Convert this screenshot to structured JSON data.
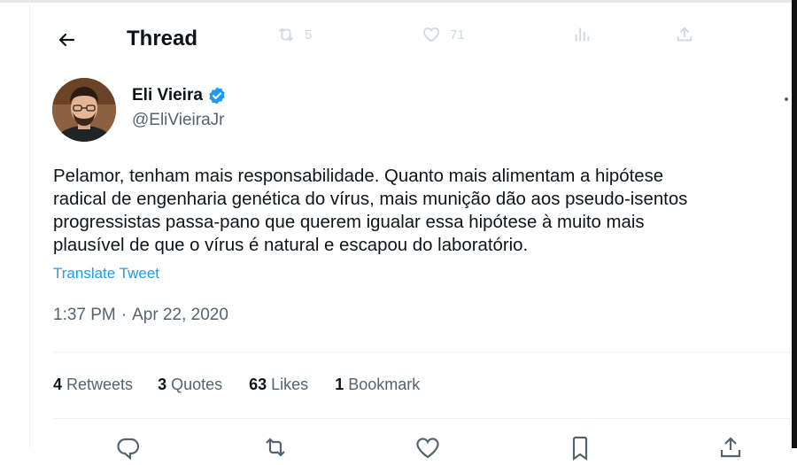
{
  "header": {
    "title": "Thread",
    "ghost_retweets": "5",
    "ghost_likes": "71"
  },
  "author": {
    "name": "Eli Vieira",
    "handle": "@EliVieiraJr"
  },
  "tweet": {
    "text": "Pelamor, tenham mais responsabilidade. Quanto mais alimentam a hipótese\nradical de engenharia genética do vírus, mais munição dão aos pseudo-isentos\nprogressistas passa-pano que querem igualar essa hipótese à muito mais\nplausível de que o vírus é natural e escapou do laboratório.",
    "translate_label": "Translate Tweet",
    "time": "1:37 PM",
    "separator": "·",
    "date": "Apr 22, 2020"
  },
  "stats": {
    "retweets_count": "4",
    "retweets_label": "Retweets",
    "quotes_count": "3",
    "quotes_label": "Quotes",
    "likes_count": "63",
    "likes_label": "Likes",
    "bookmarks_count": "1",
    "bookmarks_label": "Bookmark"
  },
  "colors": {
    "accent": "#1d9bf0",
    "secondary_text": "#536471",
    "primary_text": "#0f1419"
  },
  "icons": [
    "back-arrow-icon",
    "verified-icon",
    "more-icon",
    "reply-icon",
    "retweet-icon",
    "like-icon",
    "bookmark-icon",
    "share-icon",
    "analytics-icon"
  ]
}
